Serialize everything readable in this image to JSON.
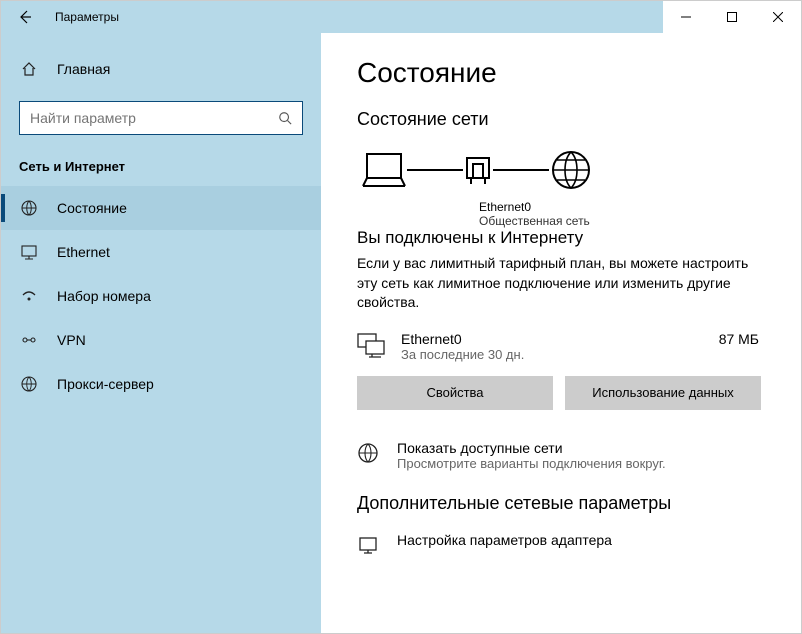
{
  "titlebar": {
    "title": "Параметры"
  },
  "sidebar": {
    "home_label": "Главная",
    "search_placeholder": "Найти параметр",
    "category": "Сеть и Интернет",
    "items": [
      {
        "label": "Состояние"
      },
      {
        "label": "Ethernet"
      },
      {
        "label": "Набор номера"
      },
      {
        "label": "VPN"
      },
      {
        "label": "Прокси-сервер"
      }
    ]
  },
  "main": {
    "page_title": "Состояние",
    "status_heading": "Состояние сети",
    "network_name": "Ethernet0",
    "network_type": "Общественная сеть",
    "connected_heading": "Вы подключены к Интернету",
    "connected_body": "Если у вас лимитный тарифный план, вы можете настроить эту сеть как лимитное подключение или изменить другие свойства.",
    "connection": {
      "name": "Ethernet0",
      "period": "За последние 30 дн.",
      "usage": "87 МБ"
    },
    "buttons": {
      "properties": "Свойства",
      "data_usage": "Использование данных"
    },
    "links": [
      {
        "title": "Показать доступные сети",
        "desc": "Просмотрите варианты подключения вокруг."
      }
    ],
    "advanced_heading": "Дополнительные сетевые параметры",
    "adapter_link": "Настройка параметров адаптера"
  }
}
